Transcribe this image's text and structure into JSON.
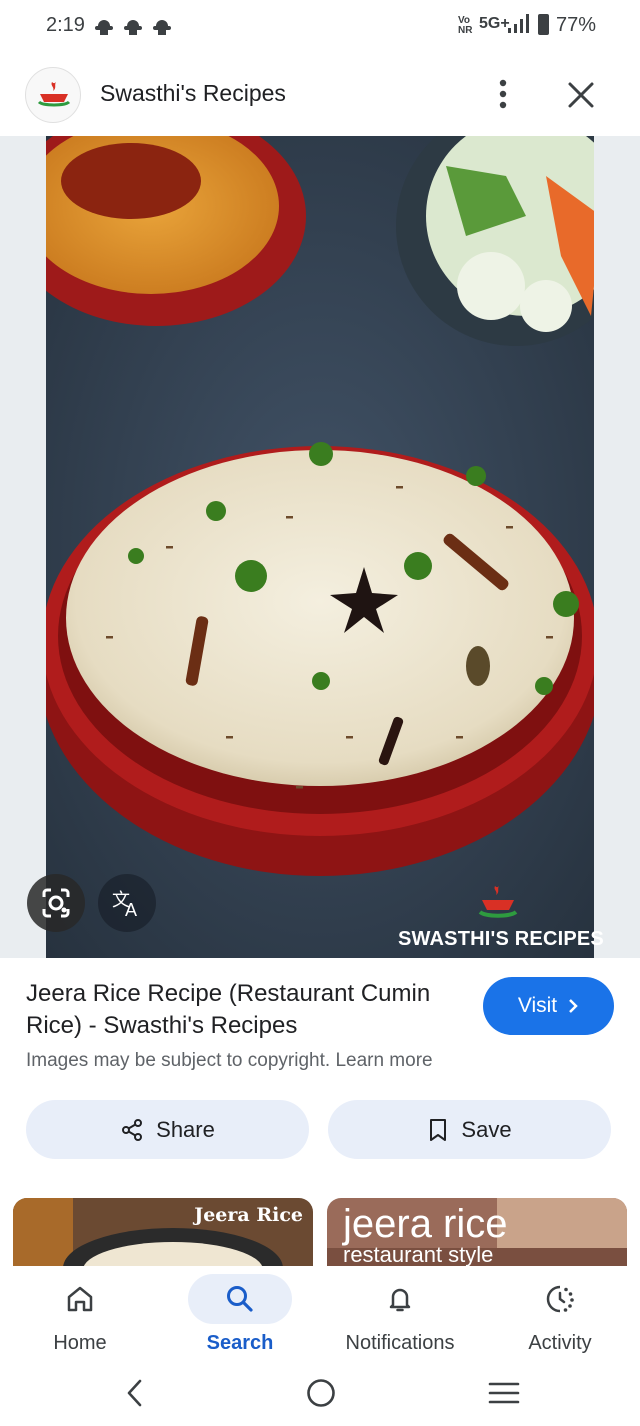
{
  "status_bar": {
    "time": "2:19",
    "network_label": "Vo\nNR",
    "network_type": "5G+",
    "battery": "77%",
    "icons": [
      "weather-icon",
      "weather-icon",
      "weather-icon",
      "signal-icon",
      "battery-icon"
    ]
  },
  "header": {
    "site_name": "Swasthi's Recipes",
    "more_icon": "more-vert-icon",
    "close_icon": "close-icon"
  },
  "image": {
    "watermark": "SWASTHI'S RECIPES",
    "lens_icon": "google-lens-icon",
    "translate_icon": "translate-icon"
  },
  "result": {
    "title": "Jeera Rice Recipe (Restaurant Cumin Rice) - Swasthi's Recipes",
    "visit_label": "Visit",
    "copyright_text": "Images may be subject to copyright.",
    "learn_more": "Learn more"
  },
  "actions": {
    "share_label": "Share",
    "save_label": "Save"
  },
  "related": {
    "thumb1_text": "Jeera Rice",
    "thumb2_title": "jeera rice",
    "thumb2_subtitle": "restaurant style"
  },
  "bottom_nav": {
    "items": [
      {
        "label": "Home",
        "icon": "home-icon"
      },
      {
        "label": "Search",
        "icon": "search-icon"
      },
      {
        "label": "Notifications",
        "icon": "bell-icon"
      },
      {
        "label": "Activity",
        "icon": "activity-icon"
      }
    ],
    "active": "Search"
  },
  "colors": {
    "accent": "#1a73e8",
    "chip_bg": "#e8eef9",
    "bowl": "#b01c1c"
  }
}
